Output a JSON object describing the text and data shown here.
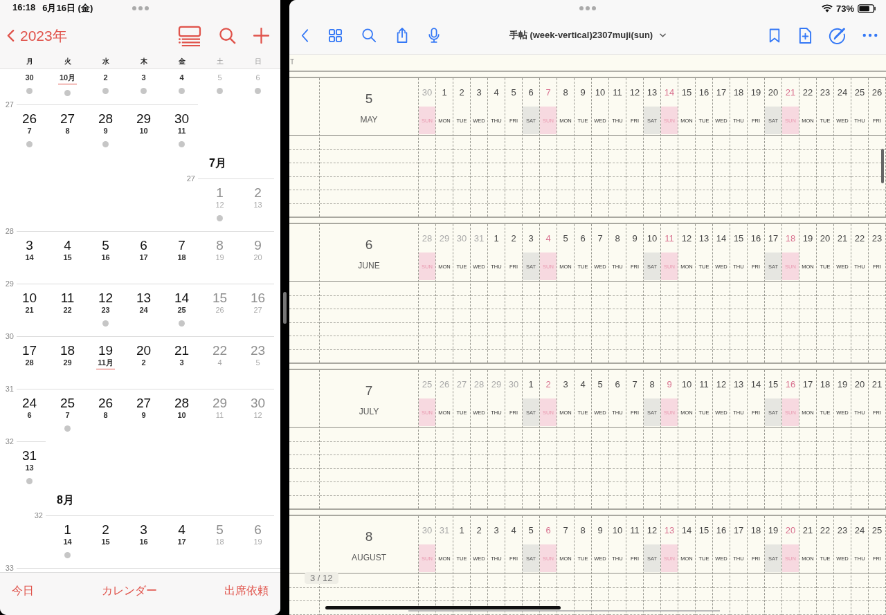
{
  "calendar": {
    "status_time": "16:18",
    "status_date": "6月16日 (金)",
    "back_label": "2023年",
    "weekday_headers": [
      {
        "label": "月",
        "dimmed": false
      },
      {
        "label": "火",
        "dimmed": false
      },
      {
        "label": "水",
        "dimmed": false
      },
      {
        "label": "木",
        "dimmed": false
      },
      {
        "label": "金",
        "dimmed": false
      },
      {
        "label": "土",
        "dimmed": true
      },
      {
        "label": "日",
        "dimmed": true
      }
    ],
    "rows": [
      {
        "kind": "partial",
        "days": [
          {
            "sub": "30",
            "dot": true,
            "dimmed": false,
            "underlined": false
          },
          {
            "sub": "10月",
            "dot": true,
            "dimmed": false,
            "underlined": true
          },
          {
            "sub": "2",
            "dot": true,
            "dimmed": false,
            "underlined": false
          },
          {
            "sub": "3",
            "dot": true,
            "dimmed": false,
            "underlined": false
          },
          {
            "sub": "4",
            "dot": true,
            "dimmed": false,
            "underlined": false
          },
          {
            "sub": "5",
            "dot": true,
            "dimmed": true,
            "underlined": false
          },
          {
            "sub": "6",
            "dot": true,
            "dimmed": true,
            "underlined": false
          }
        ]
      },
      {
        "kind": "week",
        "week_number": "27",
        "days": [
          {
            "day": "26",
            "sub": "7",
            "dot": true,
            "dimmed": false,
            "underlined": false
          },
          {
            "day": "27",
            "sub": "8",
            "dot": false,
            "dimmed": false,
            "underlined": false
          },
          {
            "day": "28",
            "sub": "9",
            "dot": true,
            "dimmed": false,
            "underlined": false
          },
          {
            "day": "29",
            "sub": "10",
            "dot": false,
            "dimmed": false,
            "underlined": false
          },
          {
            "day": "30",
            "sub": "11",
            "dot": true,
            "dimmed": false,
            "underlined": false
          }
        ]
      },
      {
        "kind": "week",
        "month_title": "7月",
        "week_number": "27",
        "days": [
          {
            "day": "1",
            "sub": "12",
            "dot": true,
            "dimmed": true,
            "underlined": false
          },
          {
            "day": "2",
            "sub": "13",
            "dot": false,
            "dimmed": true,
            "underlined": false
          }
        ]
      },
      {
        "kind": "week",
        "week_number": "28",
        "days": [
          {
            "day": "3",
            "sub": "14",
            "dot": false,
            "dimmed": false,
            "underlined": false
          },
          {
            "day": "4",
            "sub": "15",
            "dot": false,
            "dimmed": false,
            "underlined": false
          },
          {
            "day": "5",
            "sub": "16",
            "dot": false,
            "dimmed": false,
            "underlined": false
          },
          {
            "day": "6",
            "sub": "17",
            "dot": false,
            "dimmed": false,
            "underlined": false
          },
          {
            "day": "7",
            "sub": "18",
            "dot": false,
            "dimmed": false,
            "underlined": false
          },
          {
            "day": "8",
            "sub": "19",
            "dot": false,
            "dimmed": true,
            "underlined": false
          },
          {
            "day": "9",
            "sub": "20",
            "dot": false,
            "dimmed": true,
            "underlined": false
          }
        ]
      },
      {
        "kind": "week",
        "week_number": "29",
        "days": [
          {
            "day": "10",
            "sub": "21",
            "dot": false,
            "dimmed": false,
            "underlined": false
          },
          {
            "day": "11",
            "sub": "22",
            "dot": false,
            "dimmed": false,
            "underlined": false
          },
          {
            "day": "12",
            "sub": "23",
            "dot": true,
            "dimmed": false,
            "underlined": false
          },
          {
            "day": "13",
            "sub": "24",
            "dot": false,
            "dimmed": false,
            "underlined": false
          },
          {
            "day": "14",
            "sub": "25",
            "dot": true,
            "dimmed": false,
            "underlined": false
          },
          {
            "day": "15",
            "sub": "26",
            "dot": false,
            "dimmed": true,
            "underlined": false
          },
          {
            "day": "16",
            "sub": "27",
            "dot": false,
            "dimmed": true,
            "underlined": false
          }
        ]
      },
      {
        "kind": "week",
        "week_number": "30",
        "days": [
          {
            "day": "17",
            "sub": "28",
            "dot": false,
            "dimmed": false,
            "underlined": false
          },
          {
            "day": "18",
            "sub": "29",
            "dot": false,
            "dimmed": false,
            "underlined": false
          },
          {
            "day": "19",
            "sub": "11月",
            "dot": false,
            "dimmed": false,
            "underlined": true
          },
          {
            "day": "20",
            "sub": "2",
            "dot": false,
            "dimmed": false,
            "underlined": false
          },
          {
            "day": "21",
            "sub": "3",
            "dot": false,
            "dimmed": false,
            "underlined": false
          },
          {
            "day": "22",
            "sub": "4",
            "dot": false,
            "dimmed": true,
            "underlined": false
          },
          {
            "day": "23",
            "sub": "5",
            "dot": false,
            "dimmed": true,
            "underlined": false
          }
        ]
      },
      {
        "kind": "week",
        "week_number": "31",
        "days": [
          {
            "day": "24",
            "sub": "6",
            "dot": false,
            "dimmed": false,
            "underlined": false
          },
          {
            "day": "25",
            "sub": "7",
            "dot": true,
            "dimmed": false,
            "underlined": false
          },
          {
            "day": "26",
            "sub": "8",
            "dot": false,
            "dimmed": false,
            "underlined": false
          },
          {
            "day": "27",
            "sub": "9",
            "dot": false,
            "dimmed": false,
            "underlined": false
          },
          {
            "day": "28",
            "sub": "10",
            "dot": false,
            "dimmed": false,
            "underlined": false
          },
          {
            "day": "29",
            "sub": "11",
            "dot": false,
            "dimmed": true,
            "underlined": false
          },
          {
            "day": "30",
            "sub": "12",
            "dot": false,
            "dimmed": true,
            "underlined": false
          }
        ]
      },
      {
        "kind": "week",
        "week_number": "32",
        "days": [
          {
            "day": "31",
            "sub": "13",
            "dot": true,
            "dimmed": false,
            "underlined": false
          }
        ]
      },
      {
        "kind": "week",
        "month_title": "8月",
        "week_number": "32",
        "days": [
          {
            "day": "1",
            "sub": "14",
            "dot": true,
            "dimmed": false,
            "underlined": false
          },
          {
            "day": "2",
            "sub": "15",
            "dot": false,
            "dimmed": false,
            "underlined": false
          },
          {
            "day": "3",
            "sub": "16",
            "dot": false,
            "dimmed": false,
            "underlined": false
          },
          {
            "day": "4",
            "sub": "17",
            "dot": false,
            "dimmed": false,
            "underlined": false
          },
          {
            "day": "5",
            "sub": "18",
            "dot": false,
            "dimmed": true,
            "underlined": false
          },
          {
            "day": "6",
            "sub": "19",
            "dot": false,
            "dimmed": true,
            "underlined": false
          }
        ]
      },
      {
        "kind": "week",
        "week_number": "33"
      }
    ],
    "tabs": [
      "今日",
      "カレンダー",
      "出席依頼"
    ]
  },
  "reader": {
    "battery": "73%",
    "title": "手帖 (week-vertical)2307muji(sun)",
    "top_strip_text": "T",
    "page_indicator": "3 / 12",
    "months": [
      {
        "number": "5",
        "name": "MAY",
        "days": [
          {
            "date": "30",
            "weekday": "SUN",
            "kind": "sun",
            "faded": true
          },
          {
            "date": "1",
            "weekday": "MON",
            "kind": "weekday",
            "faded": false
          },
          {
            "date": "2",
            "weekday": "TUE",
            "kind": "weekday",
            "faded": false
          },
          {
            "date": "3",
            "weekday": "WED",
            "kind": "weekday",
            "faded": false
          },
          {
            "date": "4",
            "weekday": "THU",
            "kind": "weekday",
            "faded": false
          },
          {
            "date": "5",
            "weekday": "FRI",
            "kind": "weekday",
            "faded": false
          },
          {
            "date": "6",
            "weekday": "SAT",
            "kind": "sat",
            "faded": false
          },
          {
            "date": "7",
            "weekday": "SUN",
            "kind": "sun",
            "faded": false
          },
          {
            "date": "8",
            "weekday": "MON",
            "kind": "weekday",
            "faded": false
          },
          {
            "date": "9",
            "weekday": "TUE",
            "kind": "weekday",
            "faded": false
          },
          {
            "date": "10",
            "weekday": "WED",
            "kind": "weekday",
            "faded": false
          },
          {
            "date": "11",
            "weekday": "THU",
            "kind": "weekday",
            "faded": false
          },
          {
            "date": "12",
            "weekday": "FRI",
            "kind": "weekday",
            "faded": false
          },
          {
            "date": "13",
            "weekday": "SAT",
            "kind": "sat",
            "faded": false
          },
          {
            "date": "14",
            "weekday": "SUN",
            "kind": "sun",
            "faded": false
          },
          {
            "date": "15",
            "weekday": "MON",
            "kind": "weekday",
            "faded": false
          },
          {
            "date": "16",
            "weekday": "TUE",
            "kind": "weekday",
            "faded": false
          },
          {
            "date": "17",
            "weekday": "WED",
            "kind": "weekday",
            "faded": false
          },
          {
            "date": "18",
            "weekday": "THU",
            "kind": "weekday",
            "faded": false
          },
          {
            "date": "19",
            "weekday": "FRI",
            "kind": "weekday",
            "faded": false
          },
          {
            "date": "20",
            "weekday": "SAT",
            "kind": "sat",
            "faded": false
          },
          {
            "date": "21",
            "weekday": "SUN",
            "kind": "sun",
            "faded": false
          },
          {
            "date": "22",
            "weekday": "MON",
            "kind": "weekday",
            "faded": false
          },
          {
            "date": "23",
            "weekday": "TUE",
            "kind": "weekday",
            "faded": false
          },
          {
            "date": "24",
            "weekday": "WED",
            "kind": "weekday",
            "faded": false
          },
          {
            "date": "25",
            "weekday": "THU",
            "kind": "weekday",
            "faded": false
          },
          {
            "date": "26",
            "weekday": "FRI",
            "kind": "weekday",
            "faded": false
          }
        ]
      },
      {
        "number": "6",
        "name": "JUNE",
        "days": [
          {
            "date": "28",
            "weekday": "SUN",
            "kind": "sun",
            "faded": true
          },
          {
            "date": "29",
            "weekday": "MON",
            "kind": "weekday",
            "faded": true
          },
          {
            "date": "30",
            "weekday": "TUE",
            "kind": "weekday",
            "faded": true
          },
          {
            "date": "31",
            "weekday": "WED",
            "kind": "weekday",
            "faded": true
          },
          {
            "date": "1",
            "weekday": "THU",
            "kind": "weekday",
            "faded": false
          },
          {
            "date": "2",
            "weekday": "FRI",
            "kind": "weekday",
            "faded": false
          },
          {
            "date": "3",
            "weekday": "SAT",
            "kind": "sat",
            "faded": false
          },
          {
            "date": "4",
            "weekday": "SUN",
            "kind": "sun",
            "faded": false
          },
          {
            "date": "5",
            "weekday": "MON",
            "kind": "weekday",
            "faded": false
          },
          {
            "date": "6",
            "weekday": "TUE",
            "kind": "weekday",
            "faded": false
          },
          {
            "date": "7",
            "weekday": "WED",
            "kind": "weekday",
            "faded": false
          },
          {
            "date": "8",
            "weekday": "THU",
            "kind": "weekday",
            "faded": false
          },
          {
            "date": "9",
            "weekday": "FRI",
            "kind": "weekday",
            "faded": false
          },
          {
            "date": "10",
            "weekday": "SAT",
            "kind": "sat",
            "faded": false
          },
          {
            "date": "11",
            "weekday": "SUN",
            "kind": "sun",
            "faded": false
          },
          {
            "date": "12",
            "weekday": "MON",
            "kind": "weekday",
            "faded": false
          },
          {
            "date": "13",
            "weekday": "TUE",
            "kind": "weekday",
            "faded": false
          },
          {
            "date": "14",
            "weekday": "WED",
            "kind": "weekday",
            "faded": false
          },
          {
            "date": "15",
            "weekday": "THU",
            "kind": "weekday",
            "faded": false
          },
          {
            "date": "16",
            "weekday": "FRI",
            "kind": "weekday",
            "faded": false
          },
          {
            "date": "17",
            "weekday": "SAT",
            "kind": "sat",
            "faded": false
          },
          {
            "date": "18",
            "weekday": "SUN",
            "kind": "sun",
            "faded": false
          },
          {
            "date": "19",
            "weekday": "MON",
            "kind": "weekday",
            "faded": false
          },
          {
            "date": "20",
            "weekday": "TUE",
            "kind": "weekday",
            "faded": false
          },
          {
            "date": "21",
            "weekday": "WED",
            "kind": "weekday",
            "faded": false
          },
          {
            "date": "22",
            "weekday": "THU",
            "kind": "weekday",
            "faded": false
          },
          {
            "date": "23",
            "weekday": "FRI",
            "kind": "weekday",
            "faded": false
          }
        ]
      },
      {
        "number": "7",
        "name": "JULY",
        "days": [
          {
            "date": "25",
            "weekday": "SUN",
            "kind": "sun",
            "faded": true
          },
          {
            "date": "26",
            "weekday": "MON",
            "kind": "weekday",
            "faded": true
          },
          {
            "date": "27",
            "weekday": "TUE",
            "kind": "weekday",
            "faded": true
          },
          {
            "date": "28",
            "weekday": "WED",
            "kind": "weekday",
            "faded": true
          },
          {
            "date": "29",
            "weekday": "THU",
            "kind": "weekday",
            "faded": true
          },
          {
            "date": "30",
            "weekday": "FRI",
            "kind": "weekday",
            "faded": true
          },
          {
            "date": "1",
            "weekday": "SAT",
            "kind": "sat",
            "faded": false
          },
          {
            "date": "2",
            "weekday": "SUN",
            "kind": "sun",
            "faded": false
          },
          {
            "date": "3",
            "weekday": "MON",
            "kind": "weekday",
            "faded": false
          },
          {
            "date": "4",
            "weekday": "TUE",
            "kind": "weekday",
            "faded": false
          },
          {
            "date": "5",
            "weekday": "WED",
            "kind": "weekday",
            "faded": false
          },
          {
            "date": "6",
            "weekday": "THU",
            "kind": "weekday",
            "faded": false
          },
          {
            "date": "7",
            "weekday": "FRI",
            "kind": "weekday",
            "faded": false
          },
          {
            "date": "8",
            "weekday": "SAT",
            "kind": "sat",
            "faded": false
          },
          {
            "date": "9",
            "weekday": "SUN",
            "kind": "sun",
            "faded": false
          },
          {
            "date": "10",
            "weekday": "MON",
            "kind": "weekday",
            "faded": false
          },
          {
            "date": "11",
            "weekday": "TUE",
            "kind": "weekday",
            "faded": false
          },
          {
            "date": "12",
            "weekday": "WED",
            "kind": "weekday",
            "faded": false
          },
          {
            "date": "13",
            "weekday": "THU",
            "kind": "weekday",
            "faded": false
          },
          {
            "date": "14",
            "weekday": "FRI",
            "kind": "weekday",
            "faded": false
          },
          {
            "date": "15",
            "weekday": "SAT",
            "kind": "sat",
            "faded": false
          },
          {
            "date": "16",
            "weekday": "SUN",
            "kind": "sun",
            "faded": false
          },
          {
            "date": "17",
            "weekday": "MON",
            "kind": "weekday",
            "faded": false
          },
          {
            "date": "18",
            "weekday": "TUE",
            "kind": "weekday",
            "faded": false
          },
          {
            "date": "19",
            "weekday": "WED",
            "kind": "weekday",
            "faded": false
          },
          {
            "date": "20",
            "weekday": "THU",
            "kind": "weekday",
            "faded": false
          },
          {
            "date": "21",
            "weekday": "FRI",
            "kind": "weekday",
            "faded": false
          }
        ]
      },
      {
        "number": "8",
        "name": "AUGUST",
        "days": [
          {
            "date": "30",
            "weekday": "SUN",
            "kind": "sun",
            "faded": true
          },
          {
            "date": "31",
            "weekday": "MON",
            "kind": "weekday",
            "faded": true
          },
          {
            "date": "1",
            "weekday": "TUE",
            "kind": "weekday",
            "faded": false
          },
          {
            "date": "2",
            "weekday": "WED",
            "kind": "weekday",
            "faded": false
          },
          {
            "date": "3",
            "weekday": "THU",
            "kind": "weekday",
            "faded": false
          },
          {
            "date": "4",
            "weekday": "FRI",
            "kind": "weekday",
            "faded": false
          },
          {
            "date": "5",
            "weekday": "SAT",
            "kind": "sat",
            "faded": false
          },
          {
            "date": "6",
            "weekday": "SUN",
            "kind": "sun",
            "faded": false
          },
          {
            "date": "7",
            "weekday": "MON",
            "kind": "weekday",
            "faded": false
          },
          {
            "date": "8",
            "weekday": "TUE",
            "kind": "weekday",
            "faded": false
          },
          {
            "date": "9",
            "weekday": "WED",
            "kind": "weekday",
            "faded": false
          },
          {
            "date": "10",
            "weekday": "THU",
            "kind": "weekday",
            "faded": false
          },
          {
            "date": "11",
            "weekday": "FRI",
            "kind": "weekday",
            "faded": false
          },
          {
            "date": "12",
            "weekday": "SAT",
            "kind": "sat",
            "faded": false
          },
          {
            "date": "13",
            "weekday": "SUN",
            "kind": "sun",
            "faded": false
          },
          {
            "date": "14",
            "weekday": "MON",
            "kind": "weekday",
            "faded": false
          },
          {
            "date": "15",
            "weekday": "TUE",
            "kind": "weekday",
            "faded": false
          },
          {
            "date": "16",
            "weekday": "WED",
            "kind": "weekday",
            "faded": false
          },
          {
            "date": "17",
            "weekday": "THU",
            "kind": "weekday",
            "faded": false
          },
          {
            "date": "18",
            "weekday": "FRI",
            "kind": "weekday",
            "faded": false
          },
          {
            "date": "19",
            "weekday": "SAT",
            "kind": "sat",
            "faded": false
          },
          {
            "date": "20",
            "weekday": "SUN",
            "kind": "sun",
            "faded": false
          },
          {
            "date": "21",
            "weekday": "MON",
            "kind": "weekday",
            "faded": false
          },
          {
            "date": "22",
            "weekday": "TUE",
            "kind": "weekday",
            "faded": false
          },
          {
            "date": "23",
            "weekday": "WED",
            "kind": "weekday",
            "faded": false
          },
          {
            "date": "24",
            "weekday": "THU",
            "kind": "weekday",
            "faded": false
          },
          {
            "date": "25",
            "weekday": "FRI",
            "kind": "weekday",
            "faded": false
          }
        ]
      }
    ]
  }
}
